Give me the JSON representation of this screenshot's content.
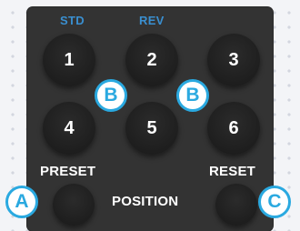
{
  "mode_labels": {
    "std": "STD",
    "rev": "REV"
  },
  "keys": [
    "1",
    "2",
    "3",
    "4",
    "5",
    "6"
  ],
  "controls": {
    "preset": "PRESET",
    "position": "POSITION",
    "reset": "RESET"
  },
  "badges": {
    "a": "A",
    "b1": "B",
    "b2": "B",
    "c": "C"
  },
  "colors": {
    "panel": "#333333",
    "mode_label": "#3a8fd0",
    "badge": "#2aa9e0"
  }
}
